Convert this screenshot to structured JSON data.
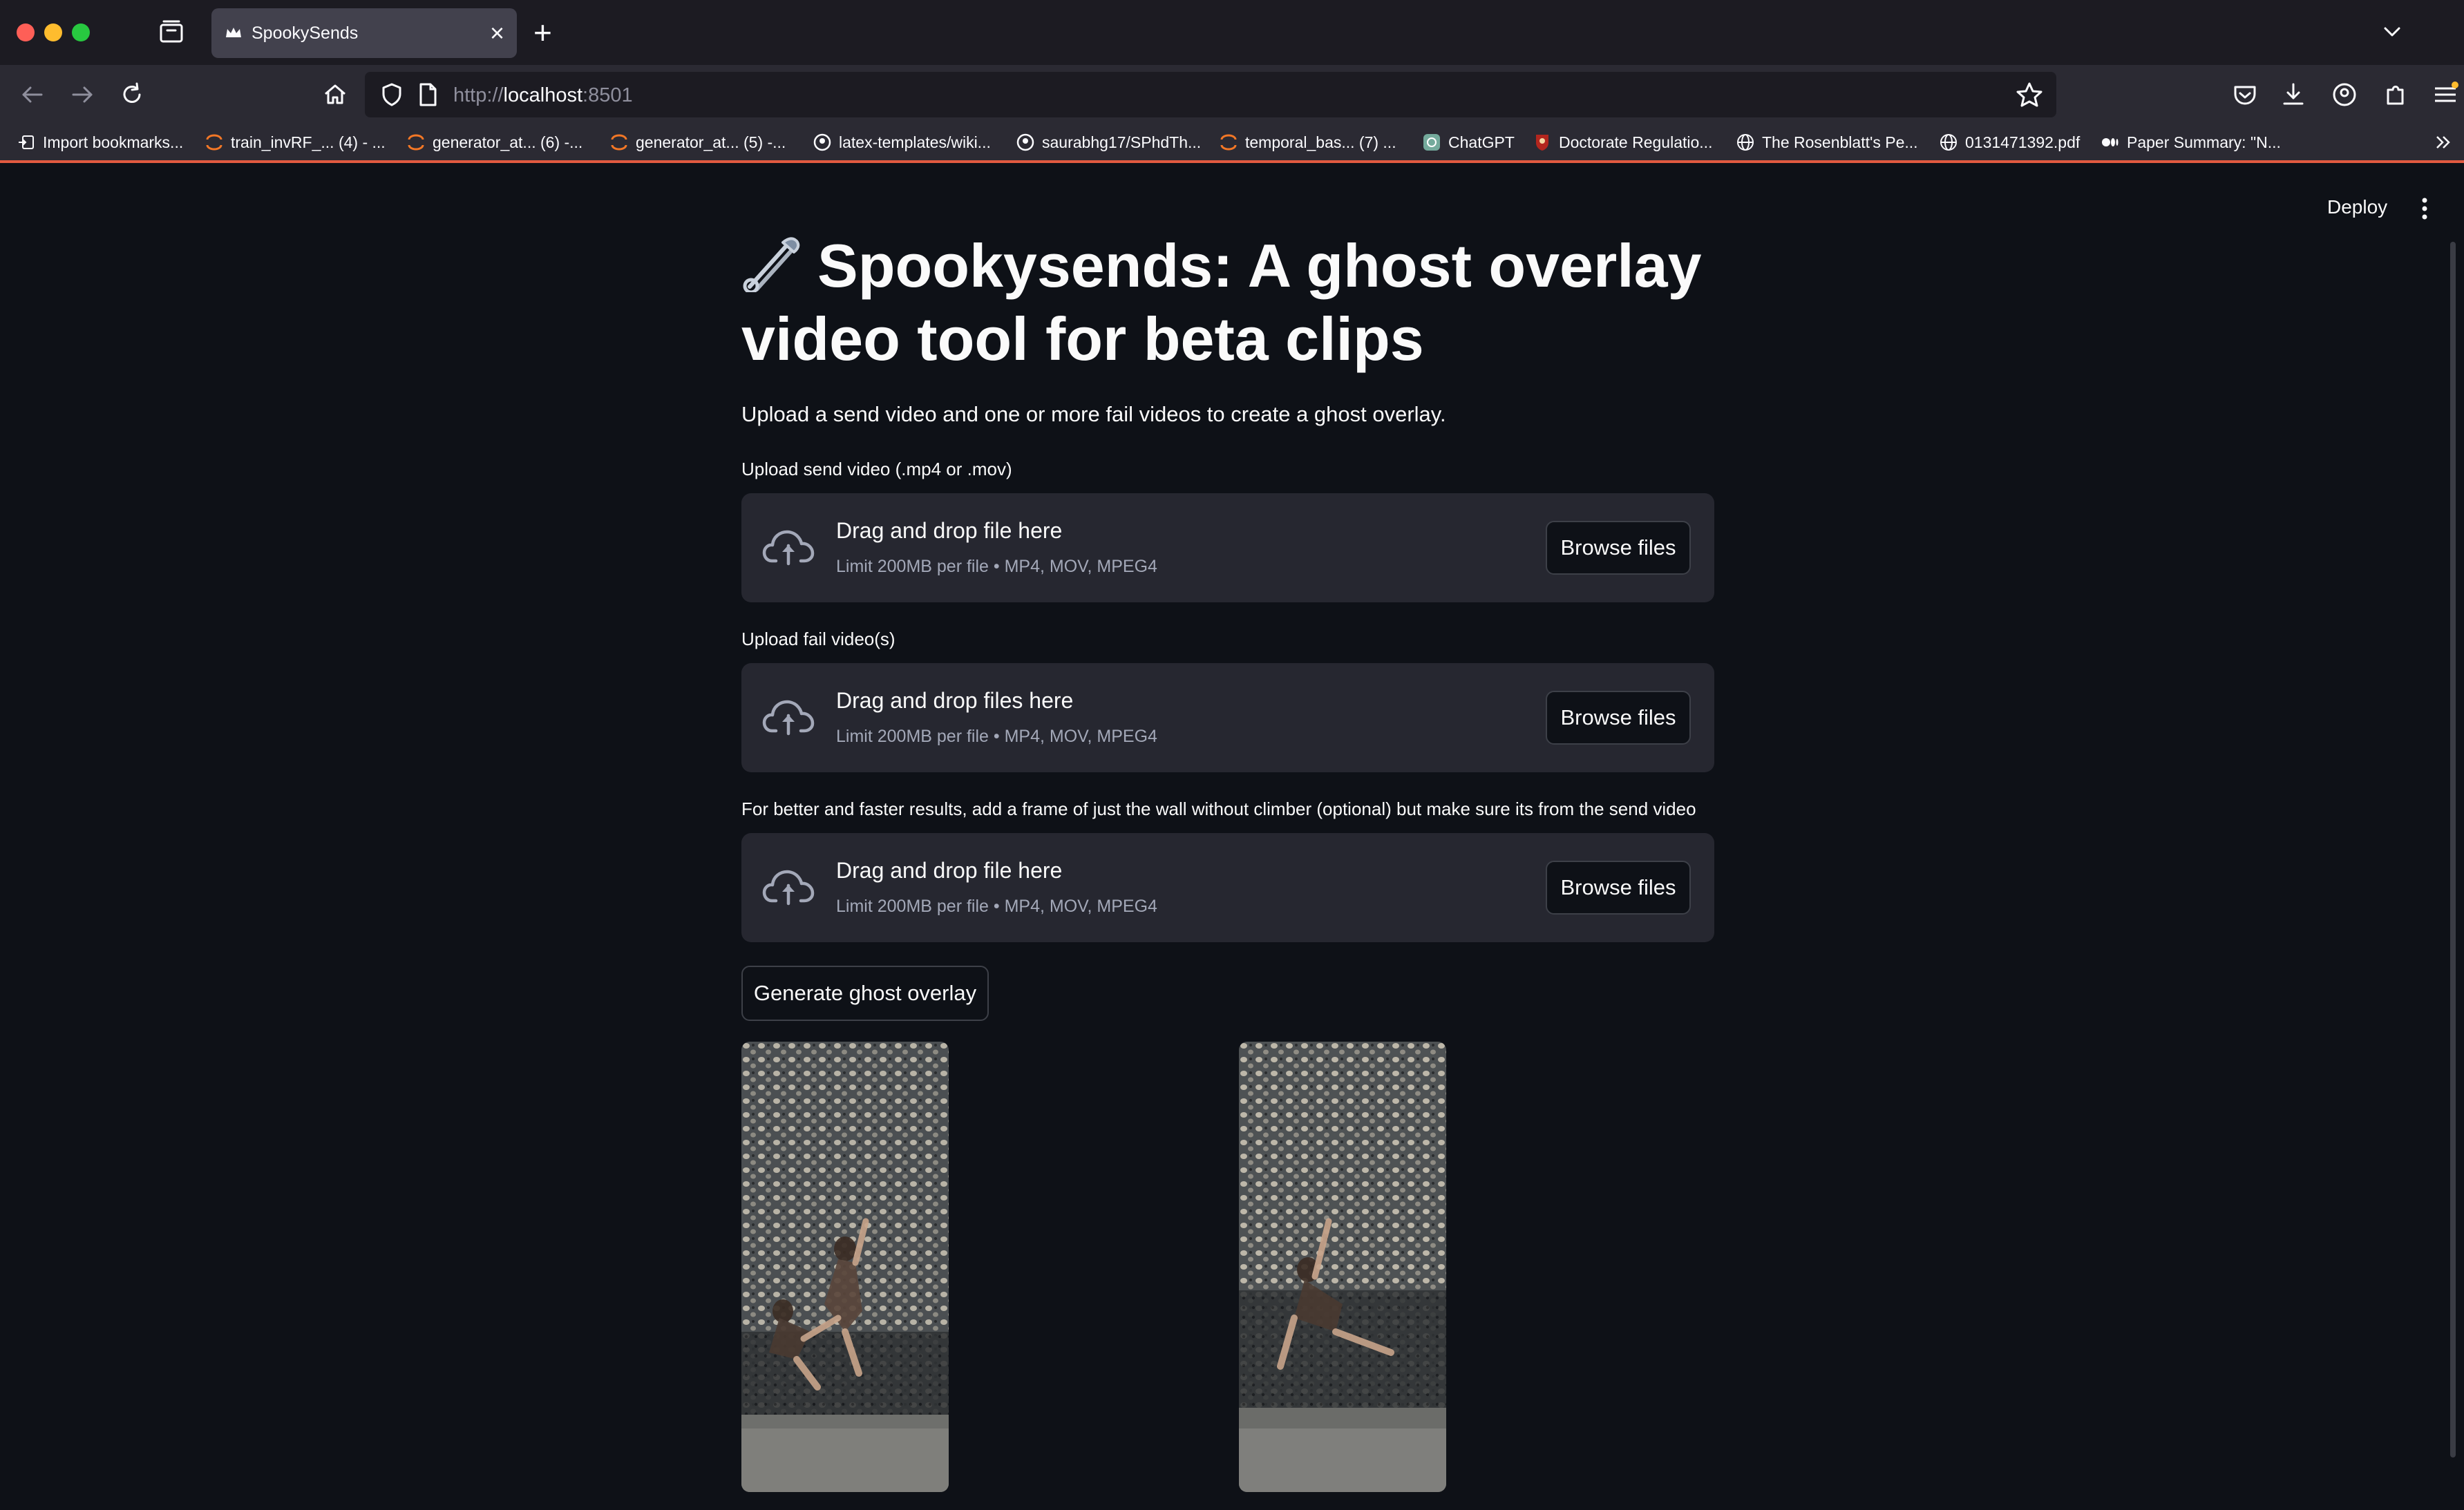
{
  "browser": {
    "tab_title": "SpookySends",
    "url_scheme": "http://",
    "url_host": "localhost",
    "url_port": ":8501",
    "bookmarks": [
      {
        "label": "Import bookmarks...",
        "icon": "import-icon"
      },
      {
        "label": "train_invRF_... (4) - ...",
        "icon": "jupyter-icon"
      },
      {
        "label": "generator_at... (6) -...",
        "icon": "jupyter-icon"
      },
      {
        "label": "generator_at... (5) -...",
        "icon": "jupyter-icon"
      },
      {
        "label": "latex-templates/wiki...",
        "icon": "github-icon"
      },
      {
        "label": "saurabhg17/SPhdTh...",
        "icon": "github-icon"
      },
      {
        "label": "temporal_bas... (7) ...",
        "icon": "jupyter-icon"
      },
      {
        "label": "ChatGPT",
        "icon": "chatgpt-icon"
      },
      {
        "label": "Doctorate Regulatio...",
        "icon": "crest-icon"
      },
      {
        "label": "The Rosenblatt's Pe...",
        "icon": "globe-icon"
      },
      {
        "label": "0131471392.pdf",
        "icon": "globe-icon"
      },
      {
        "label": "Paper Summary: \"N...",
        "icon": "medium-icon"
      }
    ]
  },
  "app": {
    "deploy_label": "Deploy",
    "title_line1": "Spookysends: A ghost overlay",
    "title_line2": "video tool for beta clips",
    "subtitle": "Upload a send video and one or more fail videos to create a ghost overlay.",
    "uploaders": [
      {
        "label": "Upload send video (.mp4 or .mov)",
        "drop_text": "Drag and drop file here",
        "limit_text": "Limit 200MB per file • MP4, MOV, MPEG4",
        "button": "Browse files"
      },
      {
        "label": "Upload fail video(s)",
        "drop_text": "Drag and drop files here",
        "limit_text": "Limit 200MB per file • MP4, MOV, MPEG4",
        "button": "Browse files"
      },
      {
        "label": "For better and faster results, add a frame of just the wall without climber (optional) but make sure its from the send video",
        "drop_text": "Drag and drop file here",
        "limit_text": "Limit 200MB per file • MP4, MOV, MPEG4",
        "button": "Browse files"
      }
    ],
    "generate_button": "Generate ghost overlay"
  },
  "colors": {
    "app_background": "#0e1117",
    "dropzone_background": "#262730",
    "browser_tab_active": "#42414d",
    "bookmark_accent": "#e25a40"
  }
}
